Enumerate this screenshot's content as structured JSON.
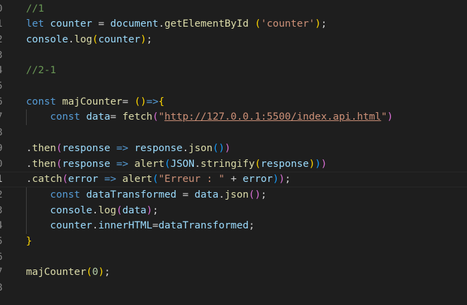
{
  "colors": {
    "background": "#1e1e1e",
    "line_number": "#858585",
    "line_number_active": "#c6c6c6",
    "comment": "#6a9955",
    "keyword": "#569cd6",
    "variable": "#9cdcfe",
    "function": "#dcdcaa",
    "plain": "#d4d4d4",
    "string": "#ce9178",
    "number": "#b5cea8",
    "bracket_level_1": "#ffd700",
    "bracket_level_2": "#da70d6",
    "bracket_level_3": "#179fff"
  },
  "editor": {
    "active_line_index": 11,
    "lines": [
      {
        "num": "0",
        "tokens": [
          {
            "t": "comment",
            "v": "//1"
          }
        ]
      },
      {
        "num": "1",
        "tokens": [
          {
            "t": "keyword",
            "v": "let"
          },
          {
            "t": "plain",
            "v": " "
          },
          {
            "t": "var",
            "v": "counter"
          },
          {
            "t": "plain",
            "v": " = "
          },
          {
            "t": "var",
            "v": "document"
          },
          {
            "t": "plain",
            "v": "."
          },
          {
            "t": "func",
            "v": "getElementById"
          },
          {
            "t": "plain",
            "v": " "
          },
          {
            "t": "brace1",
            "v": "("
          },
          {
            "t": "string",
            "v": "'counter'"
          },
          {
            "t": "brace1",
            "v": ")"
          },
          {
            "t": "plain",
            "v": ";"
          }
        ]
      },
      {
        "num": "2",
        "tokens": [
          {
            "t": "var",
            "v": "console"
          },
          {
            "t": "plain",
            "v": "."
          },
          {
            "t": "func",
            "v": "log"
          },
          {
            "t": "brace1",
            "v": "("
          },
          {
            "t": "var",
            "v": "counter"
          },
          {
            "t": "brace1",
            "v": ")"
          },
          {
            "t": "plain",
            "v": ";"
          }
        ]
      },
      {
        "num": "3",
        "tokens": []
      },
      {
        "num": "4",
        "tokens": [
          {
            "t": "comment",
            "v": "//2-1"
          }
        ]
      },
      {
        "num": "5",
        "tokens": []
      },
      {
        "num": "6",
        "tokens": [
          {
            "t": "keyword",
            "v": "const"
          },
          {
            "t": "plain",
            "v": " "
          },
          {
            "t": "func",
            "v": "majCounter"
          },
          {
            "t": "plain",
            "v": "= "
          },
          {
            "t": "brace1",
            "v": "("
          },
          {
            "t": "brace1",
            "v": ")"
          },
          {
            "t": "keyword",
            "v": "=>"
          },
          {
            "t": "brace1",
            "v": "{"
          }
        ]
      },
      {
        "num": "7",
        "tokens": [
          {
            "t": "plain",
            "v": "    "
          },
          {
            "t": "keyword",
            "v": "const"
          },
          {
            "t": "plain",
            "v": " "
          },
          {
            "t": "var",
            "v": "data"
          },
          {
            "t": "plain",
            "v": "= "
          },
          {
            "t": "func",
            "v": "fetch"
          },
          {
            "t": "brace2",
            "v": "("
          },
          {
            "t": "string",
            "v": "\""
          },
          {
            "t": "url",
            "v": "http://127.0.0.1:5500/index.api.html"
          },
          {
            "t": "string",
            "v": "\""
          },
          {
            "t": "brace2",
            "v": ")"
          }
        ]
      },
      {
        "num": "8",
        "tokens": []
      },
      {
        "num": "9",
        "tokens": [
          {
            "t": "plain",
            "v": "."
          },
          {
            "t": "func",
            "v": "then"
          },
          {
            "t": "brace2",
            "v": "("
          },
          {
            "t": "var",
            "v": "response"
          },
          {
            "t": "plain",
            "v": " "
          },
          {
            "t": "keyword",
            "v": "=>"
          },
          {
            "t": "plain",
            "v": " "
          },
          {
            "t": "var",
            "v": "response"
          },
          {
            "t": "plain",
            "v": "."
          },
          {
            "t": "func",
            "v": "json"
          },
          {
            "t": "brace3",
            "v": "()"
          },
          {
            "t": "brace2",
            "v": ")"
          }
        ]
      },
      {
        "num": "0",
        "tokens": [
          {
            "t": "plain",
            "v": "."
          },
          {
            "t": "func",
            "v": "then"
          },
          {
            "t": "brace2",
            "v": "("
          },
          {
            "t": "var",
            "v": "response"
          },
          {
            "t": "plain",
            "v": " "
          },
          {
            "t": "keyword",
            "v": "=>"
          },
          {
            "t": "plain",
            "v": " "
          },
          {
            "t": "func",
            "v": "alert"
          },
          {
            "t": "brace3",
            "v": "("
          },
          {
            "t": "var",
            "v": "JSON"
          },
          {
            "t": "plain",
            "v": "."
          },
          {
            "t": "func",
            "v": "stringify"
          },
          {
            "t": "brace1",
            "v": "("
          },
          {
            "t": "var",
            "v": "response"
          },
          {
            "t": "brace1",
            "v": ")"
          },
          {
            "t": "brace3",
            "v": ")"
          },
          {
            "t": "brace2",
            "v": ")"
          }
        ]
      },
      {
        "num": "1",
        "tokens": [
          {
            "t": "plain",
            "v": "."
          },
          {
            "t": "func",
            "v": "catch"
          },
          {
            "t": "brace2",
            "v": "("
          },
          {
            "t": "var",
            "v": "error"
          },
          {
            "t": "plain",
            "v": " "
          },
          {
            "t": "keyword",
            "v": "=>"
          },
          {
            "t": "plain",
            "v": " "
          },
          {
            "t": "func",
            "v": "alert"
          },
          {
            "t": "brace3",
            "v": "("
          },
          {
            "t": "string",
            "v": "\"Erreur : \""
          },
          {
            "t": "plain",
            "v": " + "
          },
          {
            "t": "var",
            "v": "error"
          },
          {
            "t": "brace3",
            "v": ")"
          },
          {
            "t": "brace2",
            "v": ")"
          },
          {
            "t": "plain",
            "v": ";"
          }
        ]
      },
      {
        "num": "2",
        "tokens": [
          {
            "t": "plain",
            "v": "    "
          },
          {
            "t": "keyword",
            "v": "const"
          },
          {
            "t": "plain",
            "v": " "
          },
          {
            "t": "var",
            "v": "dataTransformed"
          },
          {
            "t": "plain",
            "v": " = "
          },
          {
            "t": "var",
            "v": "data"
          },
          {
            "t": "plain",
            "v": "."
          },
          {
            "t": "func",
            "v": "json"
          },
          {
            "t": "brace2",
            "v": "()"
          },
          {
            "t": "plain",
            "v": ";"
          }
        ]
      },
      {
        "num": "3",
        "tokens": [
          {
            "t": "plain",
            "v": "    "
          },
          {
            "t": "var",
            "v": "console"
          },
          {
            "t": "plain",
            "v": "."
          },
          {
            "t": "func",
            "v": "log"
          },
          {
            "t": "brace2",
            "v": "("
          },
          {
            "t": "var",
            "v": "data"
          },
          {
            "t": "brace2",
            "v": ")"
          },
          {
            "t": "plain",
            "v": ";"
          }
        ]
      },
      {
        "num": "4",
        "tokens": [
          {
            "t": "plain",
            "v": "    "
          },
          {
            "t": "var",
            "v": "counter"
          },
          {
            "t": "plain",
            "v": "."
          },
          {
            "t": "var",
            "v": "innerHTML"
          },
          {
            "t": "plain",
            "v": "="
          },
          {
            "t": "var",
            "v": "dataTransformed"
          },
          {
            "t": "plain",
            "v": ";"
          }
        ]
      },
      {
        "num": "5",
        "tokens": [
          {
            "t": "brace1",
            "v": "}"
          }
        ]
      },
      {
        "num": "6",
        "tokens": []
      },
      {
        "num": "7",
        "tokens": [
          {
            "t": "func",
            "v": "majCounter"
          },
          {
            "t": "brace1",
            "v": "("
          },
          {
            "t": "number",
            "v": "0"
          },
          {
            "t": "brace1",
            "v": ")"
          },
          {
            "t": "plain",
            "v": ";"
          }
        ]
      },
      {
        "num": "8",
        "tokens": []
      }
    ]
  }
}
